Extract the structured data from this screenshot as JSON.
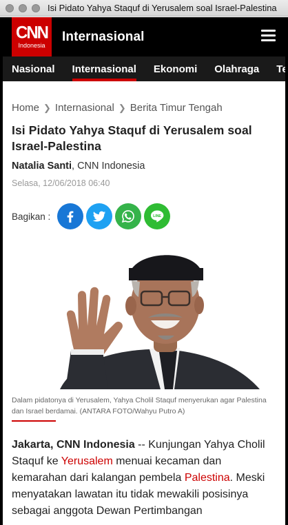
{
  "window": {
    "title": "Isi Pidato Yahya Staquf di Yerusalem soal Israel-Palestina"
  },
  "header": {
    "logo_main": "CNN",
    "logo_sub": "Indonesia",
    "section": "Internasional"
  },
  "nav": {
    "items": [
      "Nasional",
      "Internasional",
      "Ekonomi",
      "Olahraga",
      "Teknologi"
    ],
    "active": "Internasional"
  },
  "article": {
    "breadcrumb": [
      "Home",
      "Internasional",
      "Berita Timur Tengah"
    ],
    "headline": "Isi Pidato Yahya Staquf di Yerusalem soal Israel-Palestina",
    "author": "Natalia Santi",
    "outlet": ", CNN Indonesia",
    "datetime": "Selasa, 12/06/2018 06:40",
    "share_label": "Bagikan :",
    "share_icons": [
      "facebook-icon",
      "twitter-icon",
      "whatsapp-icon",
      "line-icon"
    ],
    "caption": "Dalam pidatonya di Yerusalem, Yahya Cholil Staquf menyerukan agar Palestina dan Israel berdamai. (ANTARA FOTO/Wahyu Putro A)",
    "body": {
      "dateline": "Jakarta, CNN Indonesia",
      "t1": " -- Kunjungan Yahya Cholil Staquf ke ",
      "link1": "Yerusalem",
      "t2": " menuai kecaman dan kemarahan dari kalangan pembela ",
      "link2": "Palestina",
      "t3": ". Meski menyatakan lawatan itu tidak mewakili posisinya sebagai anggota Dewan Pertimbangan"
    }
  },
  "colors": {
    "brand_red": "#cc0000",
    "header_bg": "#000000",
    "nav_bg": "#1a1a1a",
    "facebook": "#1877d6",
    "twitter": "#1ea1f2",
    "whatsapp": "#35b34a",
    "line": "#2fbc33"
  }
}
